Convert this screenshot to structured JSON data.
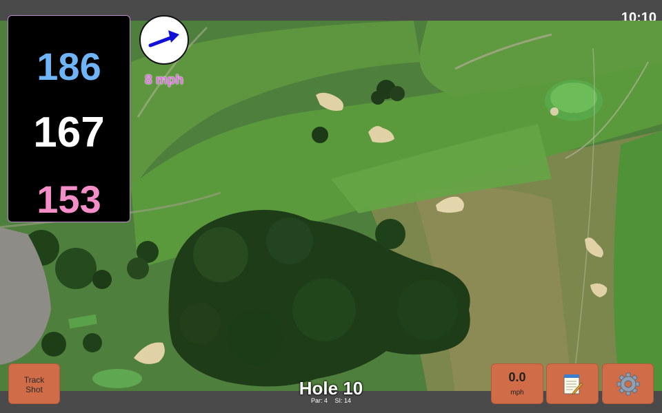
{
  "status": {
    "time": "10:10"
  },
  "distances": {
    "back": "186",
    "middle": "167",
    "front": "153"
  },
  "wind": {
    "speed": "8 mph",
    "icon": "arrow-icon"
  },
  "hole": {
    "title": "Hole 10",
    "par": "Par: 4",
    "stroke_index": "SI: 14"
  },
  "buttons": {
    "track_shot": {
      "line1": "Track",
      "line2": "Shot"
    },
    "speed": {
      "value": "0.0",
      "unit": "mph"
    },
    "notes": {
      "icon": "notepad-icon"
    },
    "settings": {
      "icon": "gear-icon"
    }
  },
  "colors": {
    "back_distance": "#6eb4f7",
    "middle_distance": "#ffffff",
    "front_distance": "#f48ec8",
    "button": "#d06c47",
    "wind_text": "#e070e6",
    "wind_arrow": "#1010d8"
  }
}
